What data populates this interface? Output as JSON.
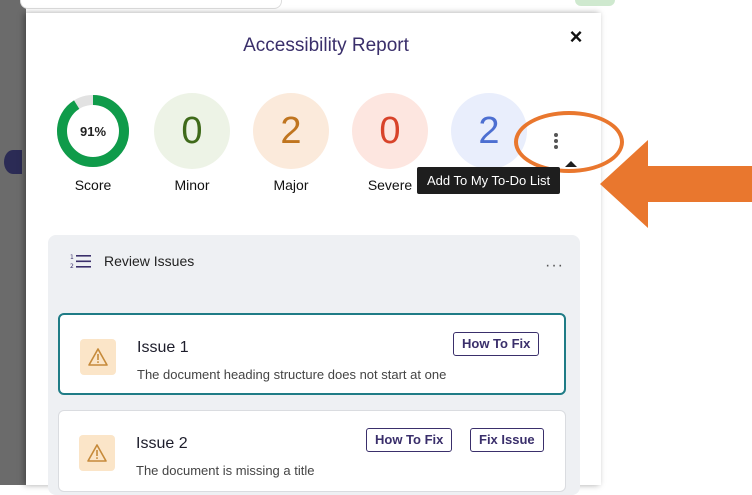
{
  "report": {
    "title": "Accessibility Report",
    "close_symbol": "×"
  },
  "stats": {
    "score": {
      "value": "91%",
      "label": "Score",
      "fraction": 0.91,
      "color": "#0f9b4a"
    },
    "minor": {
      "value": "0",
      "label": "Minor",
      "bg": "#edf3e6",
      "color": "#3f6a1a"
    },
    "major": {
      "value": "2",
      "label": "Major",
      "bg": "#fbeadb",
      "color": "#c0751f"
    },
    "severe": {
      "value": "0",
      "label": "Severe",
      "bg": "#fde6e0",
      "color": "#d8432a"
    },
    "other": {
      "value": "2",
      "bg": "#e9eefc",
      "color": "#4d6fd1"
    }
  },
  "tooltip": {
    "text": "Add To My To-Do List"
  },
  "issues": {
    "header": "Review Issues",
    "more_symbol": "···",
    "items": [
      {
        "title": "Issue 1",
        "description": "The document heading structure does not start at one",
        "buttons": [
          "How To Fix"
        ]
      },
      {
        "title": "Issue 2",
        "description": "The document is missing a title",
        "buttons": [
          "How To Fix",
          "Fix Issue"
        ]
      }
    ]
  },
  "colors": {
    "accent": "#3a2f6b",
    "highlight": "#e9772e",
    "selected_border": "#1f7c86"
  },
  "icons": [
    "close-icon",
    "more-vertical-icon",
    "numbered-list-icon",
    "more-horizontal-icon",
    "warning-icon",
    "arrow-icon"
  ]
}
